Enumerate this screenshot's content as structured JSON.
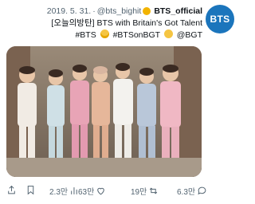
{
  "user": {
    "avatar_text": "BTS",
    "display_name": "BTS_official",
    "handle": "@bts_bighit",
    "date": "2019. 5. 31."
  },
  "tweet": {
    "line1": "[오늘의방탄] BTS with Britain's Got Talent",
    "line2": "#BTSonBGT",
    "hashtag_bts": "#BTS",
    "mention_bgt": "@BGT"
  },
  "actions": {
    "views": "2.3만",
    "likes": "63만",
    "retweets": "19만",
    "replies": "6.3만"
  },
  "colors": {
    "accent": "#1b75bc",
    "verified": "#f2b300",
    "muted": "#536471"
  }
}
